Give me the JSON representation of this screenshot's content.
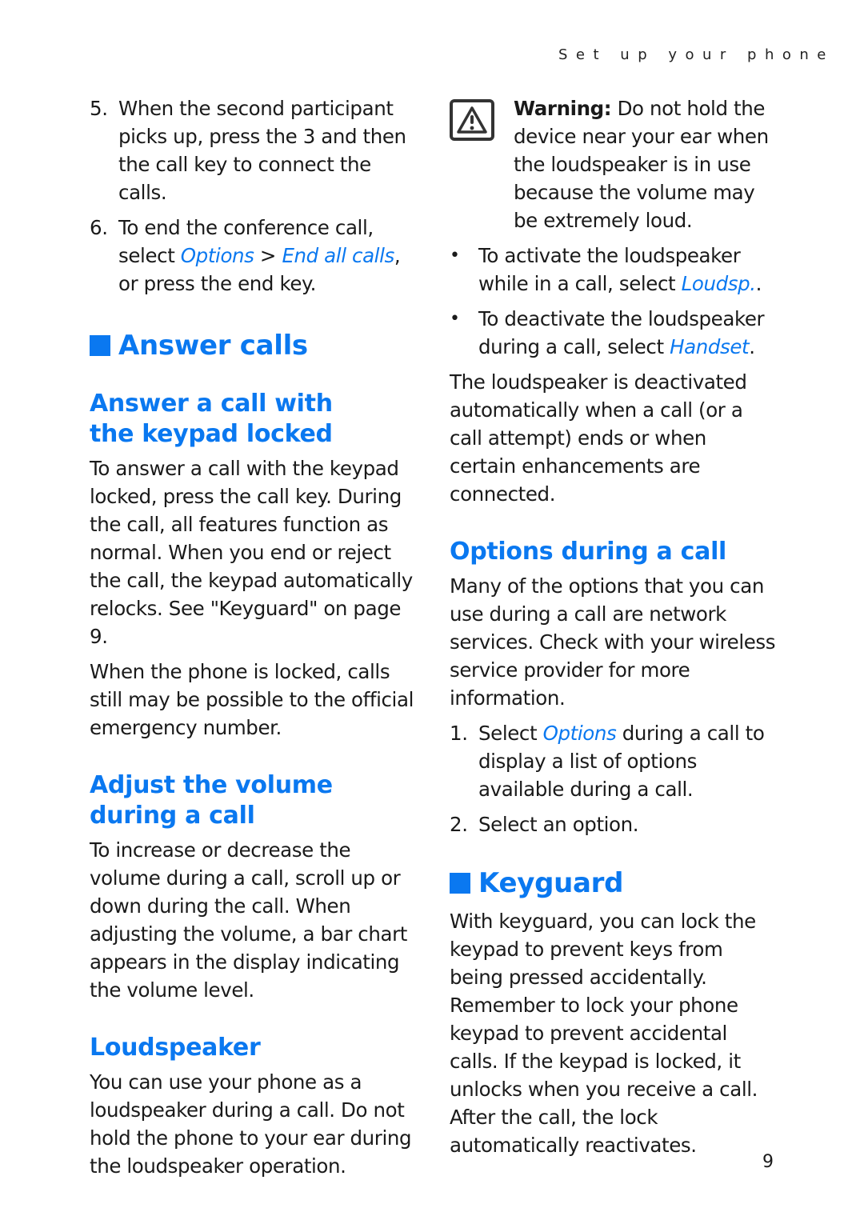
{
  "running_head": "Set up your phone",
  "page_number": "9",
  "left": {
    "steps": [
      {
        "num": "5.",
        "text": "When the second participant picks up, press the 3 and then the call key to connect the calls."
      },
      {
        "num": "6.",
        "pre": "To end the conference call, select ",
        "link1": "Options",
        "sep": " > ",
        "link2": "End all calls",
        "post": ", or press the end key."
      }
    ],
    "answer_calls": {
      "title": "Answer calls",
      "sub1": {
        "title": "Answer a call with the keypad locked",
        "p1": "To answer a call with the keypad locked, press the call key. During the call, all features function as normal. When you end or reject the call, the keypad automatically relocks. See \"Keyguard\" on page 9.",
        "p2": "When the phone is locked, calls still may be possible to the official emergency number."
      },
      "sub2": {
        "title": "Adjust the volume during a call",
        "p1": "To increase or decrease the volume during a call, scroll up or down during the call. When adjusting the volume, a bar chart appears in the display indicating the volume level."
      },
      "sub3": {
        "title": "Loudspeaker",
        "p1": "You can use your phone as a loudspeaker during a call. Do not hold the phone to your ear during the loudspeaker operation."
      }
    }
  },
  "right": {
    "warning": {
      "label": "Warning:",
      "text": " Do not hold the device near your ear when the loudspeaker is in use because the volume may be extremely loud."
    },
    "bullets": [
      {
        "pre": "To activate the loudspeaker while in a call, select ",
        "link": "Loudsp.",
        "post": "."
      },
      {
        "pre": "To deactivate the loudspeaker during a call, select ",
        "link": "Handset",
        "post": "."
      }
    ],
    "p_deactivated": "The loudspeaker is deactivated automatically when a call (or a call attempt) ends or when certain enhancements are connected.",
    "options": {
      "title": "Options during a call",
      "p1": "Many of the options that you can use during a call are network services. Check with your wireless service provider for more information.",
      "steps": [
        {
          "num": "1.",
          "pre": "Select ",
          "link": "Options",
          "post": " during a call to display a list of options available during a call."
        },
        {
          "num": "2.",
          "text": "Select an option."
        }
      ]
    },
    "keyguard": {
      "title": "Keyguard",
      "p1": "With keyguard, you can lock the keypad to prevent keys from being pressed accidentally. Remember to lock your phone keypad to prevent accidental calls. If the keypad is locked, it unlocks when you receive a call. After the call, the lock automatically reactivates."
    }
  }
}
